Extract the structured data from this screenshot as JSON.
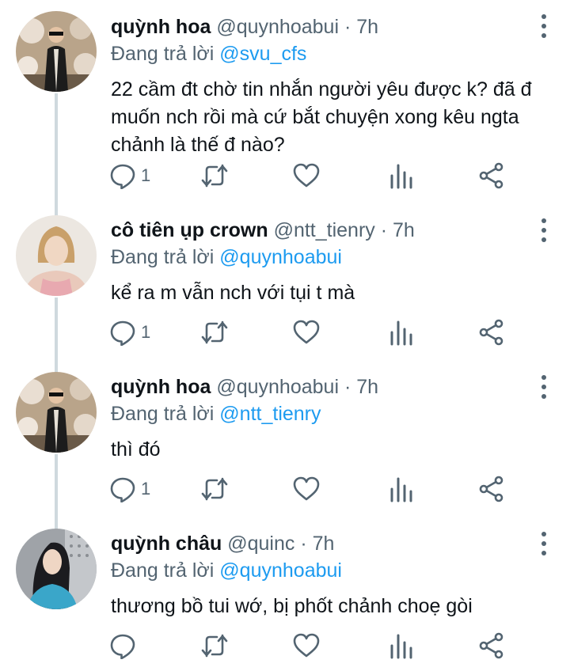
{
  "tweets": [
    {
      "name": "quỳnh hoa",
      "handle": "@quynhoabui",
      "time": "7h",
      "replying_prefix": "Đang trả lời",
      "replying_to": "@svu_cfs",
      "text": "22 cầm đt chờ tin nhắn người yêu được k? đã đ muốn nch rồi mà cứ bắt chuyện xong kêu ngta chảnh là thế đ nào?",
      "reply_count": "1"
    },
    {
      "name": "cô tiên ụp crown",
      "handle": "@ntt_tienry",
      "time": "7h",
      "replying_prefix": "Đang trả lời",
      "replying_to": "@quynhoabui",
      "text": "kể ra m vẫn nch với tụi t mà",
      "reply_count": "1"
    },
    {
      "name": "quỳnh hoa",
      "handle": "@quynhoabui",
      "time": "7h",
      "replying_prefix": "Đang trả lời",
      "replying_to": "@ntt_tienry",
      "text": "thì đó",
      "reply_count": "1"
    },
    {
      "name": "quỳnh châu",
      "handle": "@quinc",
      "time": "7h",
      "replying_prefix": "Đang trả lời",
      "replying_to": "@quynhoabui",
      "text": "thương bồ tui wớ, bị phốt chảnh choẹ gòi",
      "reply_count": ""
    }
  ],
  "separator": "·",
  "colors": {
    "text": "#0f1419",
    "secondary": "#536471",
    "link": "#1d9bf0",
    "thread_line": "#cfd9de"
  }
}
